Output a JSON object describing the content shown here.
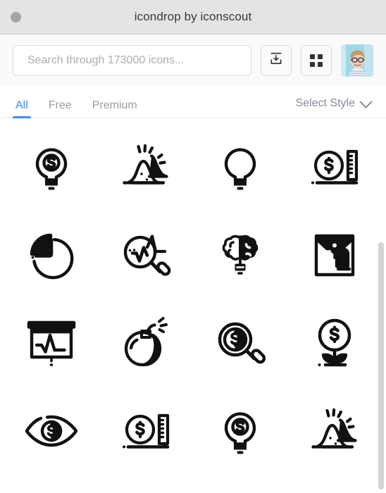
{
  "window": {
    "title": "icondrop by iconscout",
    "close_button": "window-close-dot"
  },
  "toolbar": {
    "search": {
      "placeholder": "Search through 173000 icons...",
      "value": ""
    },
    "import_button_label": "import-download",
    "grid_button_label": "grid-view",
    "avatar_label": "user-avatar"
  },
  "tabs": {
    "items": [
      {
        "label": "All",
        "active": true
      },
      {
        "label": "Free",
        "active": false
      },
      {
        "label": "Premium",
        "active": false
      }
    ],
    "style_filter": {
      "label": "Select Style"
    }
  },
  "colors": {
    "accent": "#3b8bf5",
    "titlebar": "#e4e4e4",
    "toolbar": "#fafafa",
    "muted_text": "#9b9b9b",
    "select_text": "#868a9b",
    "icon_stroke": "#111111",
    "scrollbar": "#d4d4d4"
  },
  "icon_grid": {
    "scroll_thumb": {
      "top_pct": 33,
      "height_pct": 66
    },
    "items": [
      {
        "name": "lightbulb-dollar-icon",
        "alt": "Idea money lightbulb with dollar sign"
      },
      {
        "name": "volcano-eruption-icon",
        "alt": "Erupting volcano"
      },
      {
        "name": "lightbulb-icon",
        "alt": "Plain lightbulb idea"
      },
      {
        "name": "dollar-coin-ruler-icon",
        "alt": "Dollar coin with measuring ruler"
      },
      {
        "name": "pie-chart-icon",
        "alt": "Pie chart segment"
      },
      {
        "name": "analytics-search-icon",
        "alt": "Magnifier over line chart"
      },
      {
        "name": "brain-bulb-icon",
        "alt": "Brain shaped lightbulb"
      },
      {
        "name": "document-envelope-icon",
        "alt": "Document envelope"
      },
      {
        "name": "presentation-chart-icon",
        "alt": "Presentation board with chart"
      },
      {
        "name": "bomb-icon",
        "alt": "Lit bomb"
      },
      {
        "name": "dollar-search-icon",
        "alt": "Magnifier over dollar coin"
      },
      {
        "name": "money-plant-growth-icon",
        "alt": "Dollar coin on growing plant"
      },
      {
        "name": "eye-dollar-icon",
        "alt": "Eye with dollar pupil"
      },
      {
        "name": "dollar-coin-ruler-icon-2",
        "alt": "Dollar coin with measuring ruler"
      },
      {
        "name": "lightbulb-dollar-icon-2",
        "alt": "Idea money lightbulb with dollar sign"
      },
      {
        "name": "volcano-eruption-icon-2",
        "alt": "Erupting volcano"
      }
    ]
  }
}
